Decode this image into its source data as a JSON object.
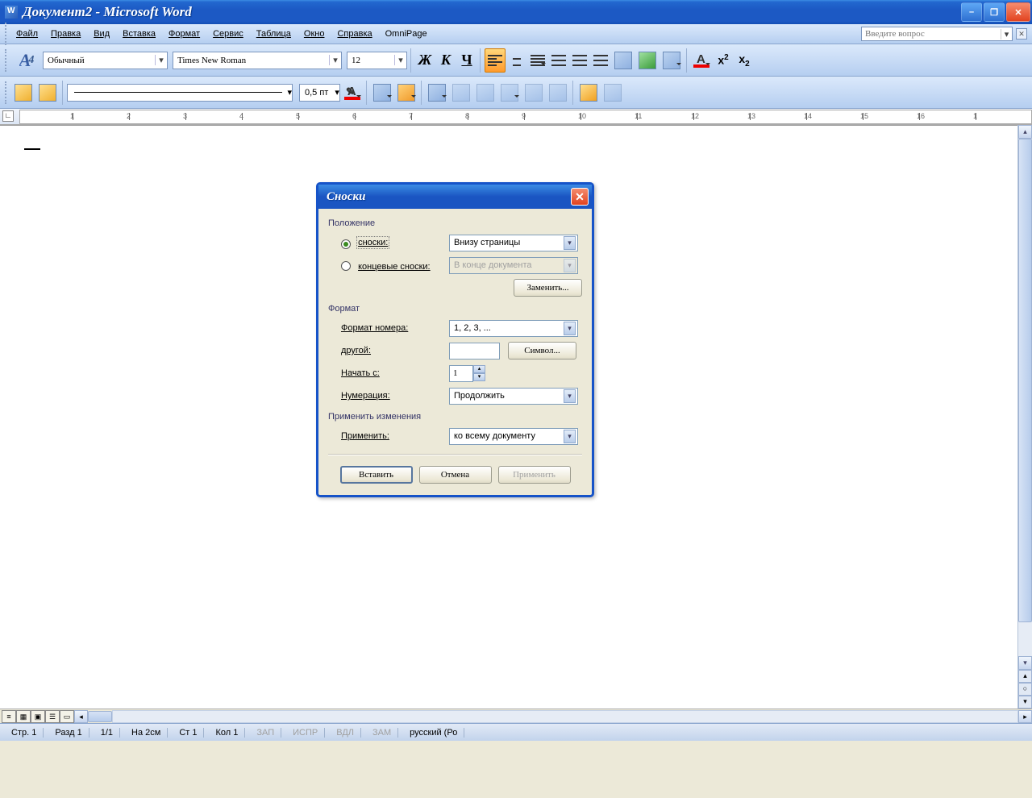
{
  "titlebar": {
    "text": "Документ2 - Microsoft Word"
  },
  "menu": {
    "file": "Файл",
    "edit": "Правка",
    "view": "Вид",
    "insert": "Вставка",
    "format": "Формат",
    "service": "Сервис",
    "table": "Таблица",
    "window": "Окно",
    "help": "Справка",
    "omnipage": "OmniPage"
  },
  "help_placeholder": "Введите вопрос",
  "toolbar1": {
    "style": "Обычный",
    "font": "Times New Roman",
    "size": "12"
  },
  "toolbar2": {
    "line_width": "0,5 пт",
    "line_width_suffix": ""
  },
  "ruler_numbers": [
    "",
    "1",
    "2",
    "3",
    "4",
    "5",
    "6",
    "7",
    "8",
    "9",
    "10",
    "11",
    "12",
    "13",
    "14",
    "15",
    "16",
    "1"
  ],
  "statusbar": {
    "page": "Стр. 1",
    "section": "Разд 1",
    "pages": "1/1",
    "at": "На 2см",
    "line": "Ст 1",
    "col": "Кол 1",
    "rec": "ЗАП",
    "trk": "ИСПР",
    "ext": "ВДЛ",
    "ovr": "ЗАМ",
    "lang": "русский (Ро"
  },
  "dialog": {
    "title": "Сноски",
    "group_position": "Положение",
    "radio_footnotes": "сноски:",
    "radio_endnotes": "концевые сноски:",
    "pos_footnotes": "Внизу страницы",
    "pos_endnotes": "В конце документа",
    "btn_replace": "Заменить...",
    "group_format": "Формат",
    "lbl_number_format": "Формат номера:",
    "val_number_format": "1, 2, 3, ...",
    "lbl_other": "другой:",
    "btn_symbol": "Символ...",
    "lbl_start_at": "Начать с:",
    "val_start_at": "1",
    "lbl_numbering": "Нумерация:",
    "val_numbering": "Продолжить",
    "group_apply": "Применить изменения",
    "lbl_apply_to": "Применить:",
    "val_apply_to": "ко всему документу",
    "btn_insert": "Вставить",
    "btn_cancel": "Отмена",
    "btn_apply": "Применить"
  }
}
